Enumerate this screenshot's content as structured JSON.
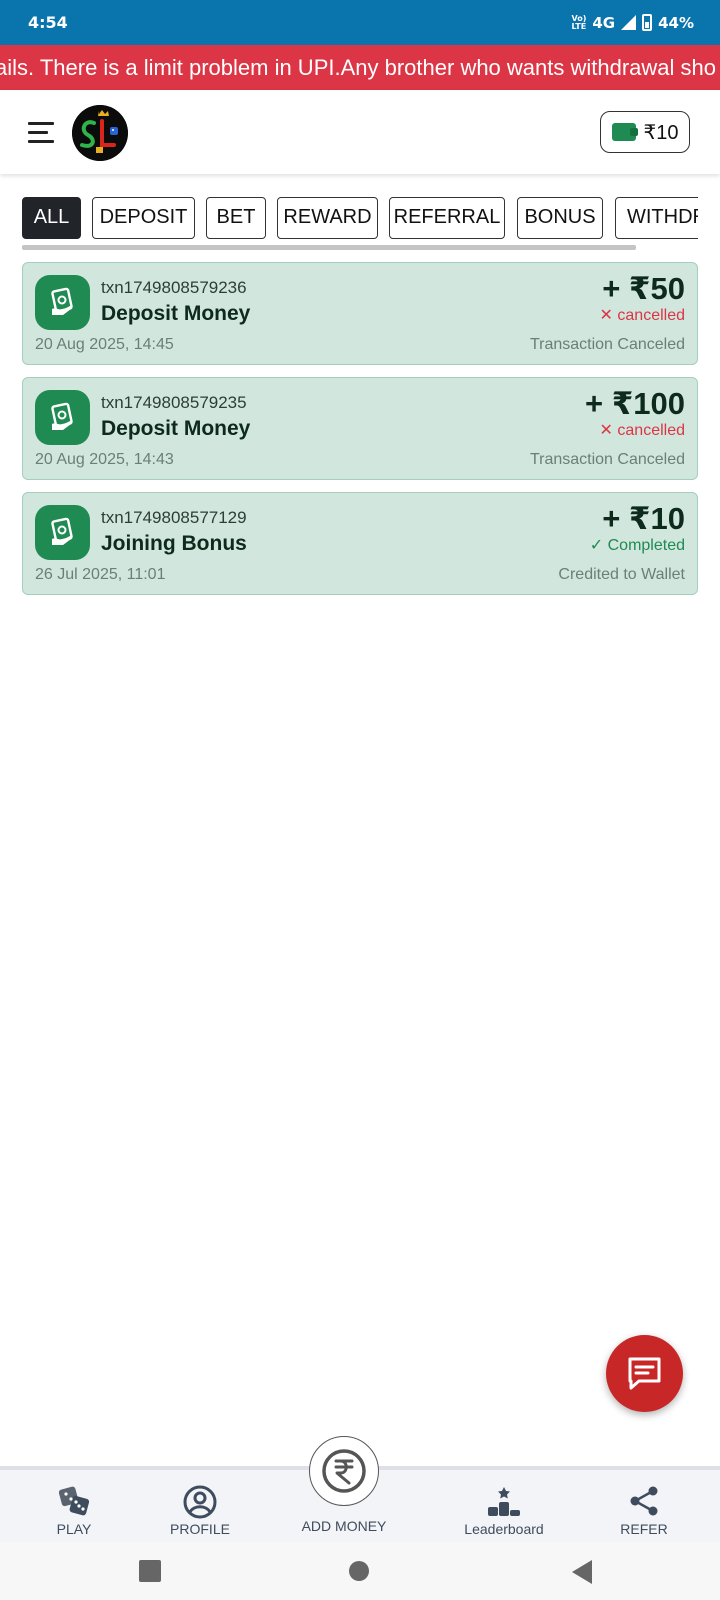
{
  "status_bar": {
    "time": "4:54",
    "network": "4G",
    "volte": "Vo) LTE",
    "battery": "44%"
  },
  "announcement": {
    "text": "ails. There is a limit problem in UPI.Any brother who wants withdrawal sho"
  },
  "header": {
    "wallet_balance": "₹10"
  },
  "tabs": [
    {
      "label": "ALL",
      "active": true
    },
    {
      "label": "DEPOSIT",
      "active": false
    },
    {
      "label": "BET",
      "active": false
    },
    {
      "label": "REWARD",
      "active": false
    },
    {
      "label": "REFERRAL",
      "active": false
    },
    {
      "label": "BONUS",
      "active": false
    },
    {
      "label": "WITHDR",
      "active": false
    }
  ],
  "transactions": [
    {
      "id": "txn1749808579236",
      "title": "Deposit Money",
      "date": "20 Aug 2025, 14:45",
      "amount": "+ ₹50",
      "status_icon": "✕",
      "status": "cancelled",
      "note": "Transaction Canceled"
    },
    {
      "id": "txn1749808579235",
      "title": "Deposit Money",
      "date": "20 Aug 2025, 14:43",
      "amount": "+ ₹100",
      "status_icon": "✕",
      "status": "cancelled",
      "note": "Transaction Canceled"
    },
    {
      "id": "txn1749808577129",
      "title": "Joining Bonus",
      "date": "26 Jul 2025, 11:01",
      "amount": "+ ₹10",
      "status_icon": "✓",
      "status": "Completed",
      "note": "Credited to Wallet"
    }
  ],
  "bottom_nav": [
    {
      "label": "PLAY",
      "icon": "dice-icon"
    },
    {
      "label": "PROFILE",
      "icon": "profile-icon"
    },
    {
      "label": "ADD MONEY",
      "icon": "rupee-icon"
    },
    {
      "label": "Leaderboard",
      "icon": "podium-icon"
    },
    {
      "label": "REFER",
      "icon": "share-icon"
    }
  ],
  "colors": {
    "status_bar": "#0a74ad",
    "announcement": "#dc3545",
    "brand_green": "#1f8a52",
    "card_bg": "#d1e7dd",
    "fab": "#c82727"
  }
}
